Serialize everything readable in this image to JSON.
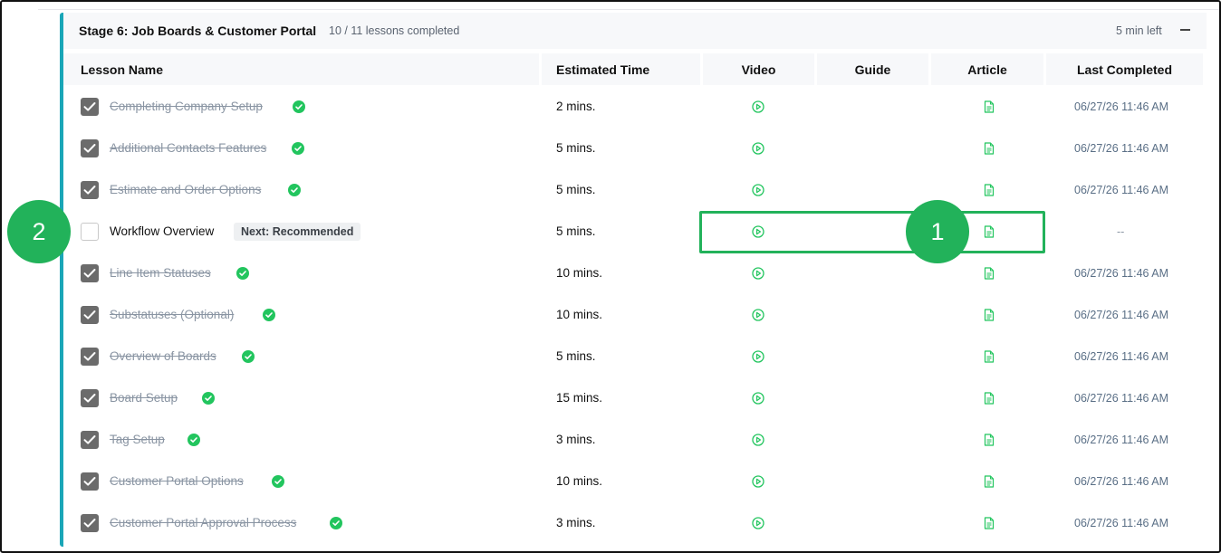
{
  "stage": {
    "title": "Stage 6: Job Boards & Customer Portal",
    "progress": "10 / 11 lessons completed",
    "time_left": "5 min left",
    "collapse_icon": "minus-icon"
  },
  "columns": {
    "lesson_name": "Lesson Name",
    "estimated_time": "Estimated Time",
    "video": "Video",
    "guide": "Guide",
    "article": "Article",
    "last_completed": "Last Completed"
  },
  "lessons": [
    {
      "name": "Completing Company Setup",
      "time": "2 mins.",
      "last": "06/27/26 11:46 AM",
      "completed": true
    },
    {
      "name": "Additional Contacts Features",
      "time": "5 mins.",
      "last": "06/27/26 11:46 AM",
      "completed": true
    },
    {
      "name": "Estimate and Order Options",
      "time": "5 mins.",
      "last": "06/27/26 11:46 AM",
      "completed": true
    },
    {
      "name": "Workflow Overview",
      "time": "5 mins.",
      "last": "--",
      "completed": false,
      "badge": "Next: Recommended"
    },
    {
      "name": "Line Item Statuses",
      "time": "10 mins.",
      "last": "06/27/26 11:46 AM",
      "completed": true
    },
    {
      "name": "Substatuses (Optional)",
      "time": "10 mins.",
      "last": "06/27/26 11:46 AM",
      "completed": true
    },
    {
      "name": "Overview of Boards",
      "time": "5 mins.",
      "last": "06/27/26 11:46 AM",
      "completed": true
    },
    {
      "name": "Board Setup",
      "time": "15 mins.",
      "last": "06/27/26 11:46 AM",
      "completed": true
    },
    {
      "name": "Tag Setup",
      "time": "3 mins.",
      "last": "06/27/26 11:46 AM",
      "completed": true
    },
    {
      "name": "Customer Portal Options",
      "time": "10 mins.",
      "last": "06/27/26 11:46 AM",
      "completed": true
    },
    {
      "name": "Customer Portal Approval Process",
      "time": "3 mins.",
      "last": "06/27/26 11:46 AM",
      "completed": true
    }
  ],
  "annotations": {
    "marker_1": "1",
    "marker_2": "2"
  },
  "colors": {
    "accent": "#1aa6b7",
    "success": "#22c55e",
    "annotation": "#22b25a"
  },
  "icons": {
    "video": "play-circle-icon",
    "article": "document-icon",
    "completed": "check-circle-icon",
    "checkbox": "checkbox-icon"
  }
}
